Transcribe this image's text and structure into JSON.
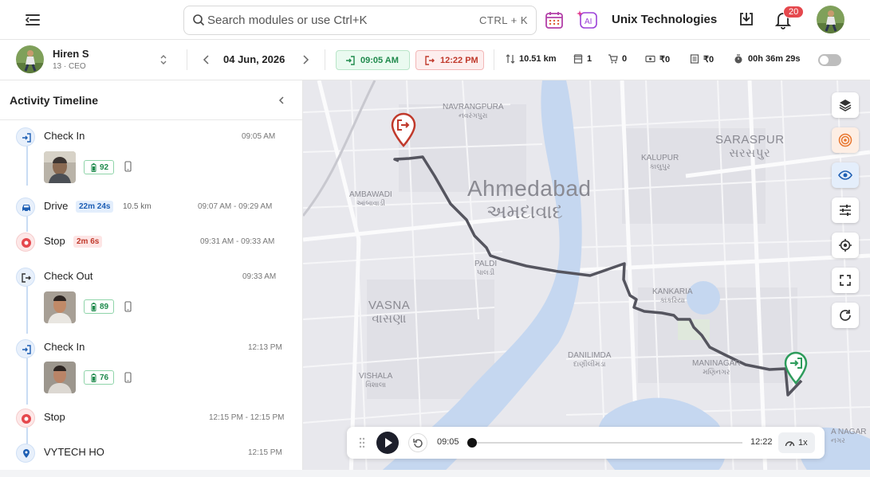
{
  "search": {
    "placeholder": "Search modules or use Ctrl+K",
    "shortcut": "CTRL + K"
  },
  "header": {
    "company": "Unix Technologies",
    "notification_count": "20"
  },
  "user": {
    "name": "Hiren S",
    "role": "13 · CEO"
  },
  "date": "04 Jun, 2026",
  "checkin_time": "09:05 AM",
  "checkout_time": "12:22 PM",
  "stats": {
    "distance": "10.51 km",
    "visits": "1",
    "orders": "0",
    "expense": "₹0",
    "payment": "₹0",
    "duration": "00h 36m 29s"
  },
  "panel": {
    "title": "Activity Timeline"
  },
  "timeline": [
    {
      "title": "Check In",
      "time": "09:05 AM",
      "battery": "92"
    },
    {
      "title": "Drive",
      "duration": "22m 24s",
      "distance": "10.5 km",
      "time": "09:07 AM - 09:29 AM"
    },
    {
      "title": "Stop",
      "duration": "2m 6s",
      "time": "09:31 AM - 09:33 AM"
    },
    {
      "title": "Check Out",
      "time": "09:33 AM",
      "battery": "89"
    },
    {
      "title": "Check In",
      "time": "12:13 PM",
      "battery": "76"
    },
    {
      "title": "Stop",
      "time": "12:15 PM - 12:15 PM"
    },
    {
      "title": "VYTECH HO",
      "time": "12:15 PM"
    }
  ],
  "map": {
    "city": "Ahmedabad",
    "city_local": "અમદાવાદ",
    "areas": [
      {
        "name": "NAVRANGPURA",
        "local": "નવરંગપુરા"
      },
      {
        "name": "SARASPUR",
        "local": "સરસપુર"
      },
      {
        "name": "KALUPUR",
        "local": "કાલુપુર"
      },
      {
        "name": "AMBAWADI",
        "local": "આંબાવાડી"
      },
      {
        "name": "PALDI",
        "local": "પાલડી"
      },
      {
        "name": "VASNA",
        "local": "વાસણા"
      },
      {
        "name": "KANKARIA",
        "local": "કાંકરિયા"
      },
      {
        "name": "DANILIMDA",
        "local": "દાણીલીમડા"
      },
      {
        "name": "VISHALA",
        "local": "વિશાલા"
      },
      {
        "name": "MANINAGAR",
        "local": "મણિનગર"
      },
      {
        "name": "A NAGAR",
        "local": "નગર"
      }
    ],
    "route_color": "#55555f"
  },
  "player": {
    "start": "09:05",
    "end": "12:22",
    "speed": "1x",
    "progress": 0
  },
  "colors": {
    "accent": "#1e5fb4",
    "checkin": "#1f8a4c",
    "checkout": "#c0392b"
  }
}
